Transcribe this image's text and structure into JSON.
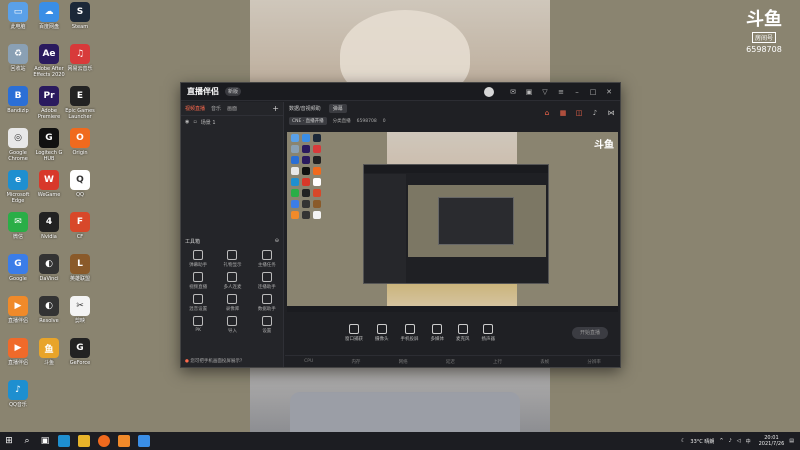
{
  "desktop": {
    "icons": [
      {
        "label": "此电脑",
        "color": "#5aa0e8",
        "glyph": "▭"
      },
      {
        "label": "百度网盘",
        "color": "#3a8ee6",
        "glyph": "☁"
      },
      {
        "label": "Steam",
        "color": "#1b2838",
        "glyph": "S"
      },
      {
        "label": "回收站",
        "color": "#8aa0b4",
        "glyph": "♻"
      },
      {
        "label": "Adobe After Effects 2020",
        "color": "#2a1a5e",
        "glyph": "Ae"
      },
      {
        "label": "网易云音乐",
        "color": "#d83a3a",
        "glyph": "♫"
      },
      {
        "label": "Bandizip",
        "color": "#2b6fd6",
        "glyph": "B"
      },
      {
        "label": "Adobe Premiere",
        "color": "#2a1a5e",
        "glyph": "Pr"
      },
      {
        "label": "Epic Games Launcher",
        "color": "#222",
        "glyph": "E"
      },
      {
        "label": "Google Chrome",
        "color": "#e8e8e8",
        "glyph": "◎"
      },
      {
        "label": "Logitech G HUB",
        "color": "#111",
        "glyph": "G"
      },
      {
        "label": "Origin",
        "color": "#f06a1e",
        "glyph": "O"
      },
      {
        "label": "Microsoft Edge",
        "color": "#1e8fd0",
        "glyph": "e"
      },
      {
        "label": "WeGame",
        "color": "#d8382a",
        "glyph": "W"
      },
      {
        "label": "QQ",
        "color": "#fff",
        "glyph": "Q"
      },
      {
        "label": "微信",
        "color": "#2aae47",
        "glyph": "✉"
      },
      {
        "label": "Nvidia",
        "color": "#222",
        "glyph": "4"
      },
      {
        "label": "CF",
        "color": "#d8482a",
        "glyph": "F"
      },
      {
        "label": "Google",
        "color": "#3b7de8",
        "glyph": "G"
      },
      {
        "label": "DaVinci",
        "color": "#333",
        "glyph": "◐"
      },
      {
        "label": "英雄联盟",
        "color": "#8a5a2a",
        "glyph": "L"
      },
      {
        "label": "直播伴侣",
        "color": "#f08a2a",
        "glyph": "▶"
      },
      {
        "label": "Resolve",
        "color": "#333",
        "glyph": "◐"
      },
      {
        "label": "剪映",
        "color": "#f4f4f4",
        "glyph": "✂"
      },
      {
        "label": "直播伴侣",
        "color": "#f06a2a",
        "glyph": "▶"
      },
      {
        "label": "斗鱼",
        "color": "#e8a42a",
        "glyph": "鱼"
      },
      {
        "label": "GeForce",
        "color": "#222",
        "glyph": "G"
      },
      {
        "label": "QQ音乐",
        "color": "#1e8fd0",
        "glyph": "♪"
      }
    ]
  },
  "room_logo": {
    "glyph": "斗鱼",
    "badge": "房间号",
    "number": "6598708"
  },
  "app": {
    "title": "直播伴侣",
    "version": "新版",
    "left_tabs": [
      "视频直播",
      "音乐",
      "画面"
    ],
    "scene_label": "场景 1",
    "tools_title": "工具箱",
    "tools": [
      "弹幕助手",
      "礼物显示",
      "主播任务",
      "视频直播",
      "多人连麦",
      "连播助手",
      "混音设置",
      "录像库",
      "数据助手",
      "PK",
      "导入",
      "设置"
    ],
    "footer_tip": "您可把手机画面投屏展示？",
    "top_tabs": [
      "数据/音视频助",
      "弹幕"
    ],
    "info": {
      "tag": "CNE · 直播开播",
      "category": "分类直播",
      "room": "6598708",
      "count": "0"
    },
    "controls": [
      "窗口捕获",
      "摄像头",
      "手机投屏",
      "多媒体",
      "麦克风",
      "扬声器"
    ],
    "start_label": "开始直播",
    "status": [
      "CPU",
      "内存",
      "网络",
      "延迟",
      "上行",
      "丢帧",
      "分辨率"
    ]
  },
  "taskbar": {
    "weather": "33°C 晴朗",
    "time": "20:01",
    "date": "2021/7/26"
  }
}
